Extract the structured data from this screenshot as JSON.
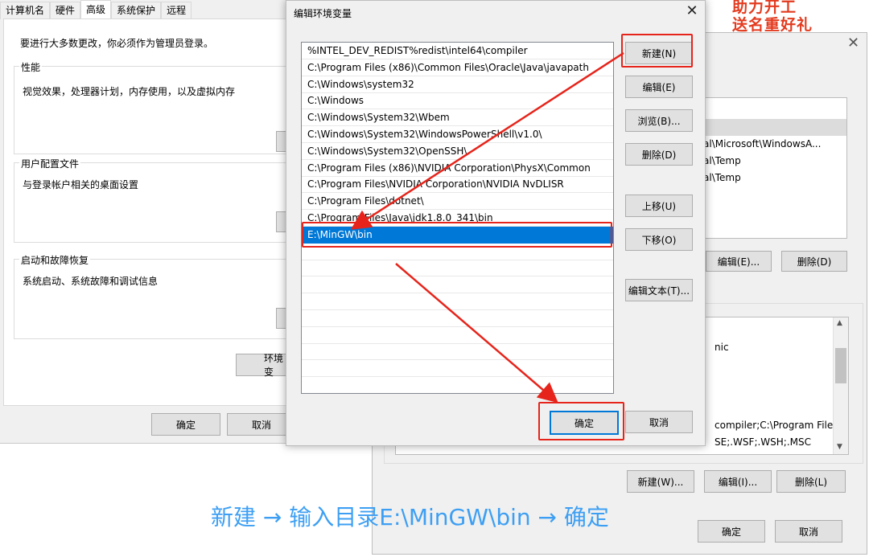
{
  "sysprops": {
    "tabs": [
      "计算机名",
      "硬件",
      "高级",
      "系统保护",
      "远程"
    ],
    "admin_notice": "要进行大多数更改，你必须作为管理员登录。",
    "performance": {
      "title": "性能",
      "desc": "视觉效果，处理器计划，内存使用，以及虚拟内存"
    },
    "user_profiles": {
      "title": "用户配置文件",
      "desc": "与登录帐户相关的桌面设置"
    },
    "startup": {
      "title": "启动和故障恢复",
      "desc": "系统启动、系统故障和调试信息"
    },
    "env_button": "环境变",
    "ok": "确定",
    "cancel": "取消"
  },
  "banner": {
    "line1": "助力开工",
    "line2": "送名重好礼"
  },
  "env_dialog": {
    "user_rows": [
      "al\\Microsoft\\WindowsA...",
      "al\\Temp",
      "al\\Temp"
    ],
    "user_edit": "编辑(E)...",
    "user_delete": "删除(D)",
    "sys_rows": [
      "nic",
      "compiler;C:\\Program File...",
      "SE;.WSF;.WSH;.MSC"
    ],
    "sys_new": "新建(W)...",
    "sys_edit": "编辑(I)...",
    "sys_delete": "删除(L)",
    "ok": "确定",
    "cancel": "取消"
  },
  "edit_dialog": {
    "title": "编辑环境变量",
    "paths": [
      "%INTEL_DEV_REDIST%redist\\intel64\\compiler",
      "C:\\Program Files (x86)\\Common Files\\Oracle\\Java\\javapath",
      "C:\\Windows\\system32",
      "C:\\Windows",
      "C:\\Windows\\System32\\Wbem",
      "C:\\Windows\\System32\\WindowsPowerShell\\v1.0\\",
      "C:\\Windows\\System32\\OpenSSH\\",
      "C:\\Program Files (x86)\\NVIDIA Corporation\\PhysX\\Common",
      "C:\\Program Files\\NVIDIA Corporation\\NVIDIA NvDLISR",
      "C:\\Program Files\\dotnet\\",
      "C:\\Program Files\\Java\\jdk1.8.0_341\\bin",
      "E:\\MinGW\\bin"
    ],
    "selected_index": 11,
    "buttons": {
      "new": "新建(N)",
      "edit": "编辑(E)",
      "browse": "浏览(B)...",
      "delete": "删除(D)",
      "move_up": "上移(U)",
      "move_down": "下移(O)",
      "edit_text": "编辑文本(T)..."
    },
    "ok": "确定",
    "cancel": "取消"
  },
  "caption": "新建 → 输入目录E:\\MinGW\\bin → 确定",
  "colors": {
    "highlight": "#e6241b",
    "selection": "#0078d7",
    "caption": "#3d9ff3"
  }
}
